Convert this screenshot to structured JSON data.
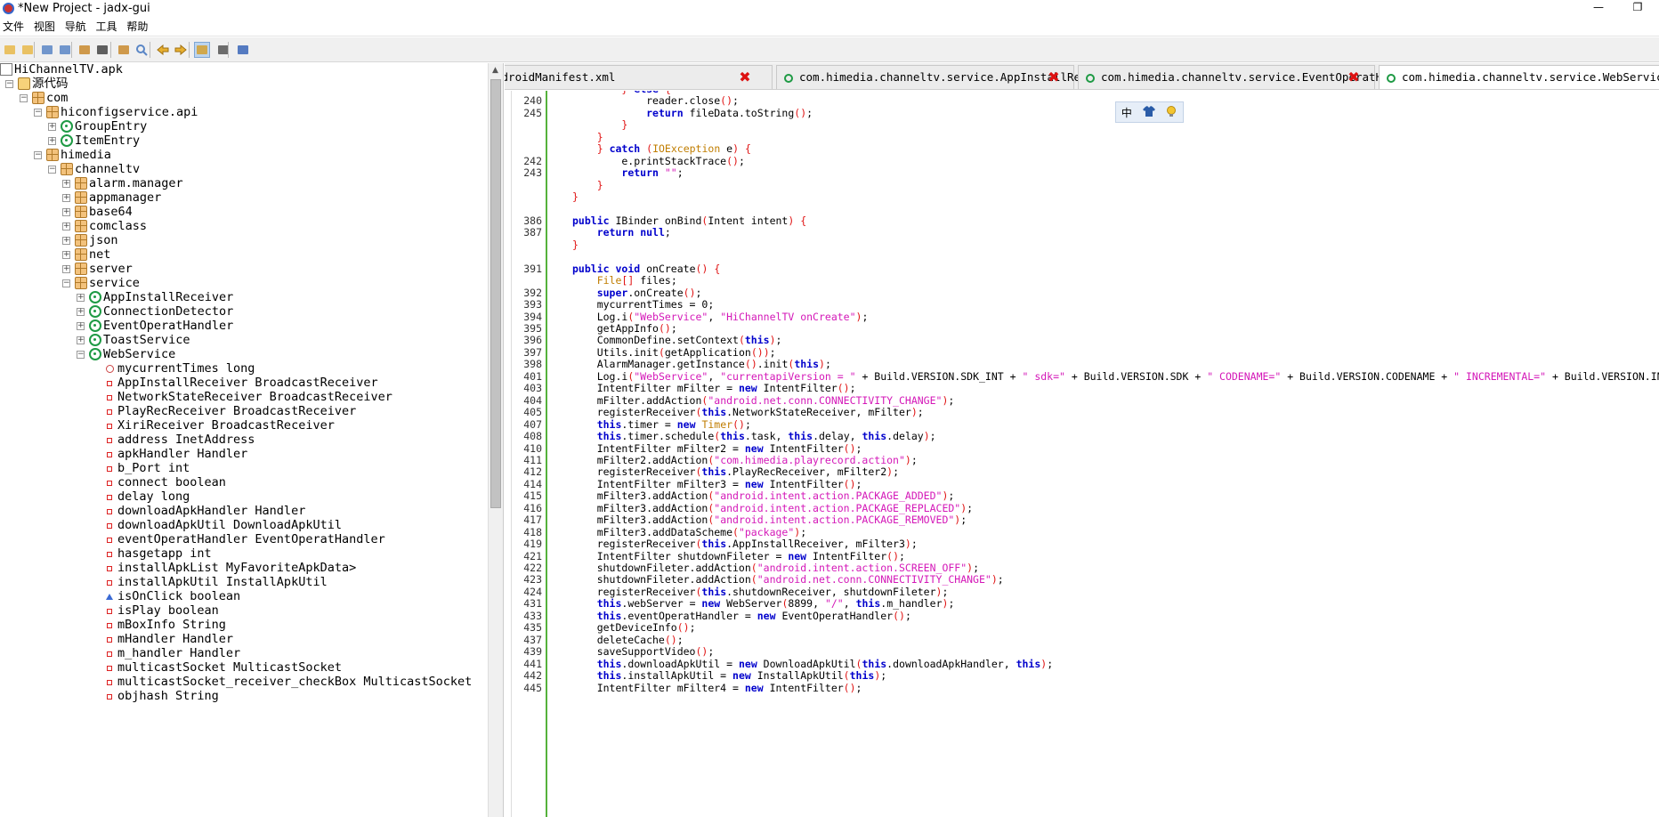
{
  "window": {
    "title": "*New Project - jadx-gui",
    "min_glyph": "—",
    "max_glyph": "❐"
  },
  "menu": [
    "文件",
    "视图",
    "导航",
    "工具",
    "帮助"
  ],
  "toolbar": {
    "icons": [
      "open-file-icon",
      "add-file-icon",
      "copy-icon",
      "copy-all-icon",
      "sync-icon",
      "flatten-icon",
      "deobfuscation-icon",
      "search-icon",
      "back-icon",
      "forward-icon",
      "auto-open-icon",
      "log-icon",
      "preferences-icon"
    ]
  },
  "tree": {
    "rows": [
      {
        "label": "HiChannelTV.apk",
        "icon": "apk"
      },
      {
        "label": "源代码",
        "icon": "src"
      },
      {
        "label": "com",
        "icon": "pkg"
      },
      {
        "label": "hiconfigservice.api",
        "icon": "pkg"
      },
      {
        "label": "GroupEntry",
        "icon": "cls"
      },
      {
        "label": "ItemEntry",
        "icon": "cls"
      },
      {
        "label": "himedia",
        "icon": "pkg"
      },
      {
        "label": "channeltv",
        "icon": "pkg"
      },
      {
        "label": "alarm.manager",
        "icon": "pkg"
      },
      {
        "label": "appmanager",
        "icon": "pkg"
      },
      {
        "label": "base64",
        "icon": "pkg"
      },
      {
        "label": "comclass",
        "icon": "pkg"
      },
      {
        "label": "json",
        "icon": "pkg"
      },
      {
        "label": "net",
        "icon": "pkg"
      },
      {
        "label": "server",
        "icon": "pkg"
      },
      {
        "label": "service",
        "icon": "pkg"
      },
      {
        "label": "AppInstallReceiver",
        "icon": "cls"
      },
      {
        "label": "ConnectionDetector",
        "icon": "cls"
      },
      {
        "label": "EventOperatHandler",
        "icon": "cls"
      },
      {
        "label": "ToastService",
        "icon": "cls"
      },
      {
        "label": "WebService",
        "icon": "cls"
      },
      {
        "label": "mycurrentTimes long",
        "icon": "fld-s"
      },
      {
        "label": "AppInstallReceiver BroadcastReceiver",
        "icon": "fld"
      },
      {
        "label": "NetworkStateReceiver BroadcastReceiver",
        "icon": "fld"
      },
      {
        "label": "PlayRecReceiver BroadcastReceiver",
        "icon": "fld"
      },
      {
        "label": "XiriReceiver BroadcastReceiver",
        "icon": "fld"
      },
      {
        "label": "address InetAddress",
        "icon": "fld"
      },
      {
        "label": "apkHandler Handler",
        "icon": "fld"
      },
      {
        "label": "b_Port int",
        "icon": "fld"
      },
      {
        "label": "connect boolean",
        "icon": "fld"
      },
      {
        "label": "delay long",
        "icon": "fld"
      },
      {
        "label": "downloadApkHandler Handler",
        "icon": "fld"
      },
      {
        "label": "downloadApkUtil DownloadApkUtil",
        "icon": "fld"
      },
      {
        "label": "eventOperatHandler EventOperatHandler",
        "icon": "fld"
      },
      {
        "label": "hasgetapp int",
        "icon": "fld"
      },
      {
        "label": "installApkList MyFavoriteApkData>",
        "icon": "fld"
      },
      {
        "label": "installApkUtil InstallApkUtil",
        "icon": "fld"
      },
      {
        "label": "isOnClick boolean",
        "icon": "fld-b"
      },
      {
        "label": "isPlay boolean",
        "icon": "fld"
      },
      {
        "label": "mBoxInfo String",
        "icon": "fld"
      },
      {
        "label": "mHandler Handler",
        "icon": "fld"
      },
      {
        "label": "m_handler Handler",
        "icon": "fld"
      },
      {
        "label": "multicastSocket MulticastSocket",
        "icon": "fld"
      },
      {
        "label": "multicastSocket_receiver_checkBox MulticastSocket",
        "icon": "fld"
      },
      {
        "label": "objhash String",
        "icon": "fld"
      }
    ]
  },
  "tabs": [
    {
      "label": "ndroidManifest.xml",
      "icon": false
    },
    {
      "label": "com.himedia.channeltv.service.AppInstallReceiver",
      "icon": true
    },
    {
      "label": "com.himedia.channeltv.service.EventOperatHandler",
      "icon": true
    },
    {
      "label": "com.himedia.channeltv.service.WebService",
      "icon": true,
      "active": true
    }
  ],
  "tab_close_glyph": "✖",
  "ime": {
    "lang": "中",
    "skin_icon": "shirt-icon",
    "tool_icon": "bulb-icon"
  },
  "code": [
    {
      "n": "",
      "t": "        } else {"
    },
    {
      "n": "240",
      "t": "            reader.close();"
    },
    {
      "n": "245",
      "t": "            return fileData.toString();"
    },
    {
      "n": "",
      "t": "        }"
    },
    {
      "n": "",
      "t": "    }"
    },
    {
      "n": "",
      "t": "    } catch (IOException e) {"
    },
    {
      "n": "242",
      "t": "        e.printStackTrace();"
    },
    {
      "n": "243",
      "t": "        return \"\";"
    },
    {
      "n": "",
      "t": "    }"
    },
    {
      "n": "",
      "t": "}"
    },
    {
      "n": "",
      "t": ""
    },
    {
      "n": "386",
      "t": "public IBinder onBind(Intent intent) {"
    },
    {
      "n": "387",
      "t": "    return null;"
    },
    {
      "n": "",
      "t": "}"
    },
    {
      "n": "",
      "t": ""
    },
    {
      "n": "391",
      "t": "public void onCreate() {"
    },
    {
      "n": "",
      "t": "    File[] files;"
    },
    {
      "n": "392",
      "t": "    super.onCreate();"
    },
    {
      "n": "393",
      "t": "    mycurrentTimes = 0;"
    },
    {
      "n": "394",
      "t": "    Log.i(\"WebService\", \"HiChannelTV onCreate\");"
    },
    {
      "n": "395",
      "t": "    getAppInfo();"
    },
    {
      "n": "396",
      "t": "    CommonDefine.setContext(this);"
    },
    {
      "n": "397",
      "t": "    Utils.init(getApplication());"
    },
    {
      "n": "398",
      "t": "    AlarmManager.getInstance().init(this);"
    },
    {
      "n": "401",
      "t": "    Log.i(\"WebService\", \"currentapiVersion = \" + Build.VERSION.SDK_INT + \" sdk=\" + Build.VERSION.SDK + \" CODENAME=\" + Build.VERSION.CODENAME + \" INCREMENTAL=\" + Build.VERSION.INC"
    },
    {
      "n": "403",
      "t": "    IntentFilter mFilter = new IntentFilter();"
    },
    {
      "n": "404",
      "t": "    mFilter.addAction(\"android.net.conn.CONNECTIVITY_CHANGE\");"
    },
    {
      "n": "405",
      "t": "    registerReceiver(this.NetworkStateReceiver, mFilter);"
    },
    {
      "n": "407",
      "t": "    this.timer = new Timer();"
    },
    {
      "n": "408",
      "t": "    this.timer.schedule(this.task, this.delay, this.delay);"
    },
    {
      "n": "410",
      "t": "    IntentFilter mFilter2 = new IntentFilter();"
    },
    {
      "n": "411",
      "t": "    mFilter2.addAction(\"com.himedia.playrecord.action\");"
    },
    {
      "n": "412",
      "t": "    registerReceiver(this.PlayRecReceiver, mFilter2);"
    },
    {
      "n": "414",
      "t": "    IntentFilter mFilter3 = new IntentFilter();"
    },
    {
      "n": "415",
      "t": "    mFilter3.addAction(\"android.intent.action.PACKAGE_ADDED\");"
    },
    {
      "n": "416",
      "t": "    mFilter3.addAction(\"android.intent.action.PACKAGE_REPLACED\");"
    },
    {
      "n": "417",
      "t": "    mFilter3.addAction(\"android.intent.action.PACKAGE_REMOVED\");"
    },
    {
      "n": "418",
      "t": "    mFilter3.addDataScheme(\"package\");"
    },
    {
      "n": "419",
      "t": "    registerReceiver(this.AppInstallReceiver, mFilter3);"
    },
    {
      "n": "421",
      "t": "    IntentFilter shutdownFileter = new IntentFilter();"
    },
    {
      "n": "422",
      "t": "    shutdownFileter.addAction(\"android.intent.action.SCREEN_OFF\");"
    },
    {
      "n": "423",
      "t": "    shutdownFileter.addAction(\"android.net.conn.CONNECTIVITY_CHANGE\");"
    },
    {
      "n": "424",
      "t": "    registerReceiver(this.shutdownReceiver, shutdownFileter);"
    },
    {
      "n": "431",
      "t": "    this.webServer = new WebServer(8899, \"/\", this.m_handler);"
    },
    {
      "n": "433",
      "t": "    this.eventOperatHandler = new EventOperatHandler();"
    },
    {
      "n": "435",
      "t": "    getDeviceInfo();"
    },
    {
      "n": "437",
      "t": "    deleteCache();"
    },
    {
      "n": "439",
      "t": "    saveSupportVideo();"
    },
    {
      "n": "441",
      "t": "    this.downloadApkUtil = new DownloadApkUtil(this.downloadApkHandler, this);"
    },
    {
      "n": "442",
      "t": "    this.installApkUtil = new InstallApkUtil(this);"
    },
    {
      "n": "445",
      "t": "    IntentFilter mFilter4 = new IntentFilter();"
    }
  ]
}
